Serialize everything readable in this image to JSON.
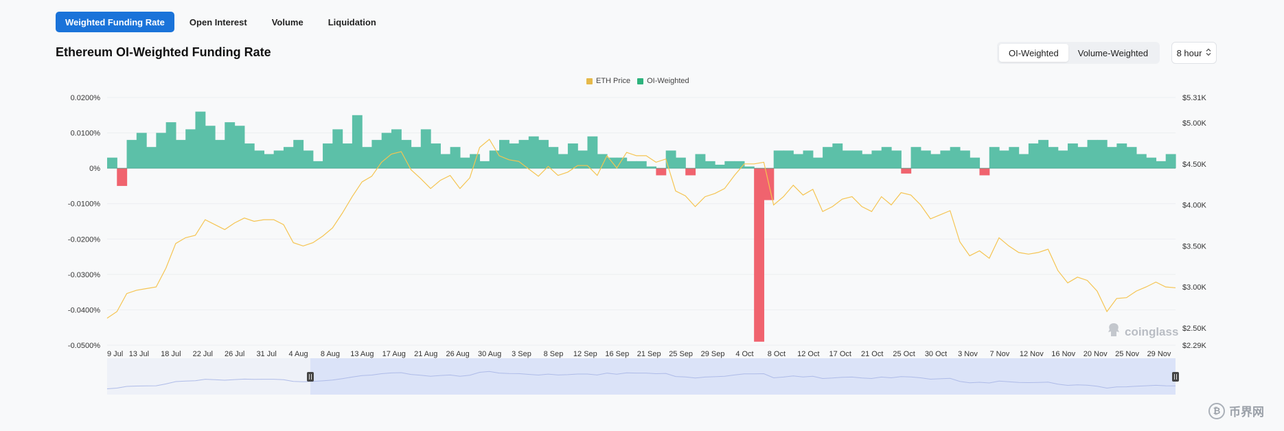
{
  "tabs": [
    {
      "label": "Weighted Funding Rate",
      "active": true
    },
    {
      "label": "Open Interest",
      "active": false
    },
    {
      "label": "Volume",
      "active": false
    },
    {
      "label": "Liquidation",
      "active": false
    }
  ],
  "title": "Ethereum OI-Weighted Funding Rate",
  "segment": {
    "options": [
      "OI-Weighted",
      "Volume-Weighted"
    ],
    "selected": "OI-Weighted"
  },
  "interval": {
    "label": "8 hour",
    "icon": "updown-chevron-icon"
  },
  "watermark": "coinglass",
  "corner_logo": "币界网",
  "colors": {
    "positive": "#5cc0a8",
    "negative": "#f0636e",
    "price": "#f5c451",
    "navigator": "#dbe3f8"
  },
  "chart_data": {
    "type": "area",
    "legend": [
      "ETH Price",
      "OI-Weighted"
    ],
    "legend_colors": [
      "#e6b94a",
      "#2db37d"
    ],
    "y_left_ticks": [
      "0.0200%",
      "0.0100%",
      "0%",
      "-0.0100%",
      "-0.0200%",
      "-0.0300%",
      "-0.0400%",
      "-0.0500%"
    ],
    "y_right_ticks": [
      "$5.31K",
      "$5.00K",
      "$4.50K",
      "$4.00K",
      "$3.50K",
      "$3.00K",
      "$2.50K",
      "$2.29K"
    ],
    "ylim_left": [
      -0.05,
      0.02
    ],
    "ylim_right": [
      2290,
      5310
    ],
    "x_ticks": [
      "9 Jul",
      "13 Jul",
      "18 Jul",
      "22 Jul",
      "26 Jul",
      "31 Jul",
      "4 Aug",
      "8 Aug",
      "13 Aug",
      "17 Aug",
      "21 Aug",
      "26 Aug",
      "30 Aug",
      "3 Sep",
      "8 Sep",
      "12 Sep",
      "16 Sep",
      "21 Sep",
      "25 Sep",
      "29 Sep",
      "4 Oct",
      "8 Oct",
      "12 Oct",
      "17 Oct",
      "21 Oct",
      "25 Oct",
      "30 Oct",
      "3 Nov",
      "7 Nov",
      "12 Nov",
      "16 Nov",
      "20 Nov",
      "25 Nov",
      "29 Nov"
    ],
    "funding_rate": [
      0.003,
      -0.005,
      0.008,
      0.01,
      0.006,
      0.01,
      0.013,
      0.008,
      0.011,
      0.016,
      0.012,
      0.008,
      0.013,
      0.012,
      0.007,
      0.005,
      0.004,
      0.005,
      0.006,
      0.008,
      0.005,
      0.002,
      0.007,
      0.011,
      0.007,
      0.015,
      0.006,
      0.008,
      0.01,
      0.011,
      0.008,
      0.006,
      0.011,
      0.007,
      0.004,
      0.006,
      0.003,
      0.004,
      0.002,
      0.005,
      0.008,
      0.007,
      0.008,
      0.009,
      0.008,
      0.006,
      0.004,
      0.007,
      0.005,
      0.009,
      0.004,
      0.003,
      0.003,
      0.002,
      0.002,
      0.0005,
      -0.002,
      0.005,
      0.003,
      -0.002,
      0.004,
      0.002,
      0.001,
      0.002,
      0.002,
      0.0005,
      -0.049,
      -0.009,
      0.005,
      0.005,
      0.004,
      0.005,
      0.003,
      0.006,
      0.007,
      0.005,
      0.005,
      0.004,
      0.005,
      0.006,
      0.005,
      -0.0015,
      0.006,
      0.005,
      0.004,
      0.005,
      0.006,
      0.005,
      0.003,
      -0.002,
      0.006,
      0.005,
      0.006,
      0.004,
      0.007,
      0.008,
      0.006,
      0.005,
      0.007,
      0.006,
      0.008,
      0.008,
      0.006,
      0.007,
      0.006,
      0.004,
      0.003,
      0.002,
      0.004
    ],
    "eth_price": [
      2620,
      2700,
      2920,
      2960,
      2980,
      3000,
      3230,
      3530,
      3600,
      3630,
      3820,
      3760,
      3700,
      3780,
      3840,
      3800,
      3820,
      3820,
      3760,
      3540,
      3500,
      3540,
      3620,
      3720,
      3900,
      4100,
      4280,
      4350,
      4520,
      4620,
      4650,
      4430,
      4320,
      4200,
      4300,
      4360,
      4200,
      4330,
      4700,
      4800,
      4600,
      4550,
      4530,
      4440,
      4350,
      4470,
      4360,
      4400,
      4480,
      4480,
      4360,
      4600,
      4450,
      4640,
      4600,
      4600,
      4520,
      4560,
      4170,
      4110,
      3980,
      4100,
      4140,
      4200,
      4360,
      4500,
      4500,
      4520,
      4000,
      4100,
      4240,
      4120,
      4190,
      3920,
      3980,
      4070,
      4100,
      3980,
      3920,
      4100,
      4000,
      4150,
      4120,
      4000,
      3830,
      3880,
      3930,
      3550,
      3380,
      3440,
      3350,
      3600,
      3500,
      3420,
      3400,
      3420,
      3460,
      3200,
      3050,
      3120,
      3080,
      2950,
      2700,
      2860,
      2870,
      2950,
      3000,
      3060,
      3000,
      2990
    ]
  }
}
